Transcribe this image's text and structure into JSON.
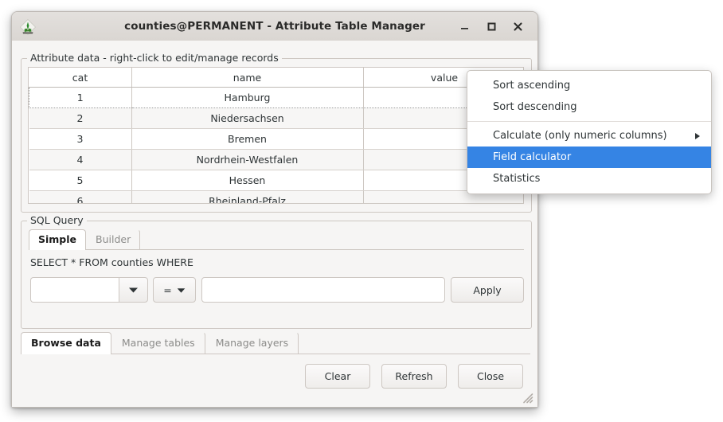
{
  "window": {
    "title": "counties@PERMANENT - Attribute Table Manager",
    "app_icon": "grass-gis-icon",
    "controls": {
      "minimize": "–",
      "maximize": "□",
      "close": "×"
    }
  },
  "attribute_group": {
    "title": "Attribute data - right-click to edit/manage records",
    "columns": [
      "cat",
      "name",
      "value"
    ],
    "rows": [
      {
        "cat": "1",
        "name": "Hamburg",
        "value": ""
      },
      {
        "cat": "2",
        "name": "Niedersachsen",
        "value": ""
      },
      {
        "cat": "3",
        "name": "Bremen",
        "value": ""
      },
      {
        "cat": "4",
        "name": "Nordrhein-Westfalen",
        "value": ""
      },
      {
        "cat": "5",
        "name": "Hessen",
        "value": ""
      },
      {
        "cat": "6",
        "name": "Rheinland-Pfalz",
        "value": ""
      }
    ]
  },
  "sql_group": {
    "title": "SQL Query",
    "tabs": [
      {
        "label": "Simple",
        "active": true
      },
      {
        "label": "Builder",
        "active": false
      }
    ],
    "statement": "SELECT * FROM counties WHERE",
    "column_combo": {
      "value": "",
      "placeholder": ""
    },
    "operator_combo": {
      "value": "="
    },
    "value_input": {
      "value": "",
      "placeholder": ""
    },
    "apply_label": "Apply"
  },
  "main_tabs": [
    {
      "label": "Browse data",
      "active": true
    },
    {
      "label": "Manage tables",
      "active": false
    },
    {
      "label": "Manage layers",
      "active": false
    }
  ],
  "bottom_buttons": [
    {
      "label": "Clear"
    },
    {
      "label": "Refresh"
    },
    {
      "label": "Close"
    }
  ],
  "context_menu": {
    "items": [
      {
        "label": "Sort ascending",
        "highlight": false,
        "submenu": false
      },
      {
        "label": "Sort descending",
        "highlight": false,
        "submenu": false
      },
      {
        "label": "Calculate (only numeric columns)",
        "highlight": false,
        "submenu": true
      },
      {
        "label": "Field calculator",
        "highlight": true,
        "submenu": false
      },
      {
        "label": "Statistics",
        "highlight": false,
        "submenu": false
      }
    ]
  },
  "colors": {
    "highlight": "#3584e4",
    "window_bg": "#f6f5f4",
    "titlebar": "#dedad6",
    "border": "#cdc7c2",
    "text": "#2e3436"
  }
}
